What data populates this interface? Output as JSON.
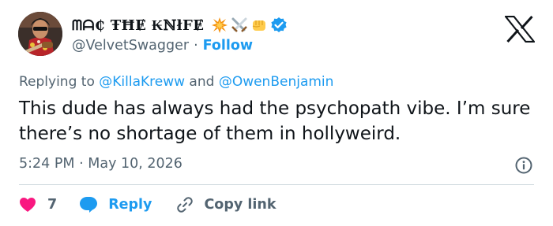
{
  "author": {
    "display_name": "ᗰᗩ₵ ŦĦɆ ₭ℕłFɆ",
    "handle": "@VelvetSwagger",
    "separator": "·",
    "follow_label": "Follow",
    "name_emojis": [
      "collision-emoji",
      "crossed-swords-emoji",
      "fist-emoji"
    ],
    "verified": true
  },
  "reply_context": {
    "prefix": "Replying to",
    "mention1": "@KillaKreww",
    "and": "and",
    "mention2": "@OwenBenjamin"
  },
  "tweet": {
    "text": "This dude has always had the psychopath vibe. I’m sure there’s no shortage of them in hollyweird.",
    "time": "5:24 PM",
    "separator": "·",
    "date": "May 10, 2026"
  },
  "actions": {
    "like_count": "7",
    "reply_label": "Reply",
    "copy_label": "Copy link"
  },
  "colors": {
    "accent": "#1d9bf0",
    "like": "#f91880",
    "secondary_text": "#536471",
    "divider": "#cfd9de"
  }
}
